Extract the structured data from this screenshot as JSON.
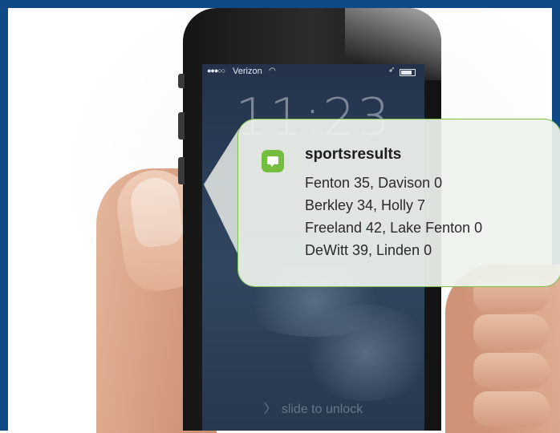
{
  "frame": {
    "border_color": "#0f4a86"
  },
  "lockscreen": {
    "carrier": "Verizon",
    "signal_dots": "●●●○○",
    "time": "11:23",
    "unlock_text": "slide to unlock",
    "unlock_chevron": "〉"
  },
  "notification": {
    "app_name": "sportsresults",
    "icon": "message-icon",
    "accent_color": "#74bd3e",
    "lines": [
      "Fenton 35, Davison 0",
      "Berkley 34, Holly 7",
      "Freeland 42, Lake Fenton 0",
      "DeWitt 39, Linden 0"
    ]
  }
}
